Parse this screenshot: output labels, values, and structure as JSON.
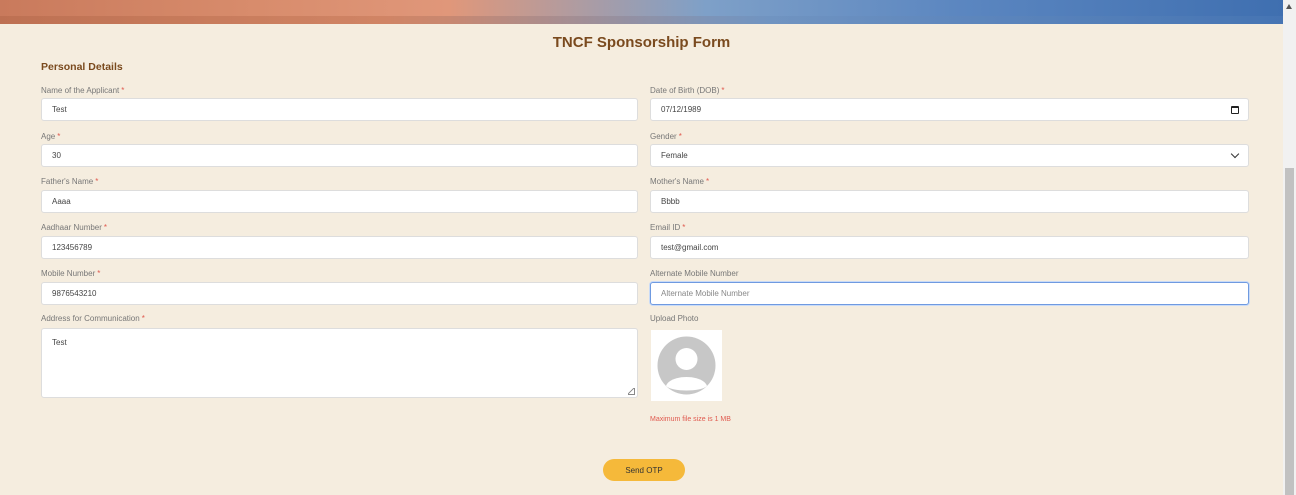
{
  "form": {
    "title": "TNCF Sponsorship Form",
    "section": "Personal Details",
    "required_marker": "*",
    "fields": {
      "name": {
        "label": "Name of the Applicant",
        "value": "Test"
      },
      "dob": {
        "label": "Date of Birth (DOB)",
        "value": "07/12/1989"
      },
      "age": {
        "label": "Age",
        "value": "30"
      },
      "gender": {
        "label": "Gender",
        "value": "Female"
      },
      "father": {
        "label": "Father's Name",
        "value": "Aaaa"
      },
      "mother": {
        "label": "Mother's Name",
        "value": "Bbbb"
      },
      "aadhaar": {
        "label": "Aadhaar Number",
        "value": "123456789"
      },
      "email": {
        "label": "Email ID",
        "value": "test@gmail.com"
      },
      "mobile": {
        "label": "Mobile Number",
        "value": "9876543210"
      },
      "alt_mobile": {
        "label": "Alternate Mobile Number",
        "value": "",
        "placeholder": "Alternate Mobile Number"
      },
      "address": {
        "label": "Address for Communication",
        "value": "Test"
      },
      "photo": {
        "label": "Upload Photo",
        "note": "Maximum file size is 1 MB"
      }
    },
    "submit_label": "Send OTP"
  },
  "colors": {
    "background": "#f5eddf",
    "heading": "#7a4a1e",
    "required": "#e05a4f",
    "button": "#f5b93a",
    "focus": "#6f9ae0"
  },
  "icons": {
    "dob": "calendar-icon",
    "gender": "chevron-down-icon",
    "photo": "avatar-placeholder-icon",
    "scroll": "scroll-up-arrow-icon"
  }
}
